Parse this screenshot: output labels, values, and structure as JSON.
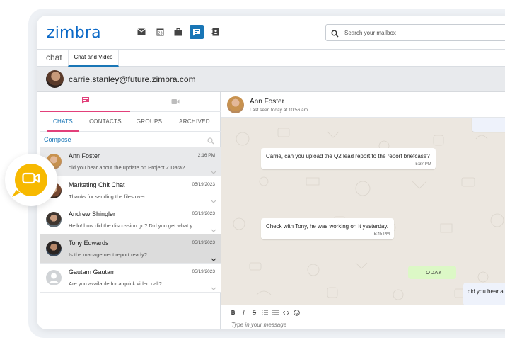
{
  "app": {
    "logo": "zimbra"
  },
  "header": {
    "search": {
      "placeholder": "Search your mailbox"
    },
    "app_icons": [
      "mail-icon",
      "calendar-icon",
      "briefcase-icon",
      "chat-icon",
      "contacts-icon"
    ]
  },
  "tabs": {
    "app_name": "chat",
    "active_tab": "Chat and Video"
  },
  "user": {
    "email": "carrie.stanley@future.zimbra.com"
  },
  "left_panel": {
    "mode_tabs": [
      "chat-icon",
      "video-icon"
    ],
    "subtabs": [
      "CHATS",
      "CONTACTS",
      "GROUPS",
      "ARCHIVED"
    ],
    "compose_label": "Compose",
    "chats": [
      {
        "name": "Ann Foster",
        "time": "2:16 PM",
        "preview": "did you hear about the update on Project Z Data?"
      },
      {
        "name": "Marketing Chit Chat",
        "time": "05/19/2023",
        "preview": "Thanks for sending the files over."
      },
      {
        "name": "Andrew Shingler",
        "time": "05/19/2023",
        "preview": "Hello! how did the discussion go? Did you get what y..."
      },
      {
        "name": "Tony Edwards",
        "time": "05/19/2023",
        "preview": "Is the management report ready?"
      },
      {
        "name": "Gautam Gautam",
        "time": "05/19/2023",
        "preview": "Are you available for a quick video call?"
      }
    ]
  },
  "conversation": {
    "name": "Ann Foster",
    "status": "Last seen today at 10:56 am",
    "messages": [
      {
        "text": "Carrie, can you upload the Q2 lead report to the report briefcase?",
        "time": "5:37 PM"
      },
      {
        "text": "Check with Tony, he was working on it yesterday.",
        "time": "5:45 PM"
      },
      {
        "text": "did you hear a",
        "time": ""
      }
    ],
    "day_separator": "TODAY",
    "composer_placeholder": "Type in your message"
  },
  "colors": {
    "brand": "#0b69c7",
    "accent_pink": "#e2407a",
    "badge_yellow": "#f7b900",
    "today_green": "#dcf8c6"
  }
}
